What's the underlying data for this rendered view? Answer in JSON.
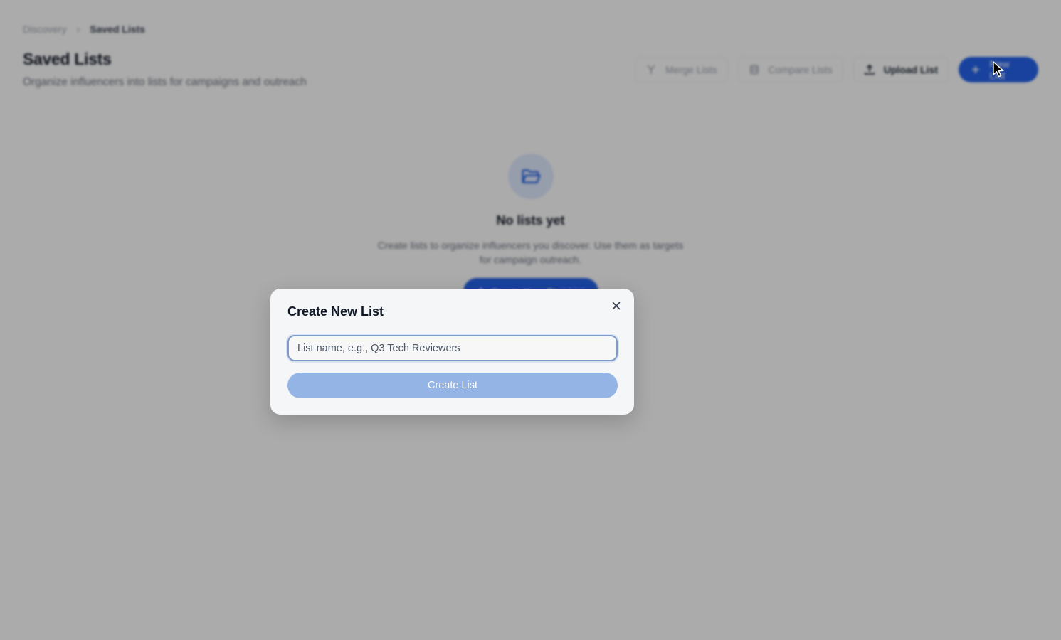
{
  "breadcrumb": {
    "parent": "Discovery",
    "separator": "›",
    "current": "Saved Lists"
  },
  "header": {
    "title": "Saved Lists",
    "subtitle": "Organize influencers into lists for campaigns and outreach"
  },
  "actions": {
    "merge_label": "Merge Lists",
    "compare_label": "Compare Lists",
    "upload_label": "Upload List",
    "new_label": "New List"
  },
  "empty_state": {
    "title": "No lists yet",
    "text": "Create lists to organize influencers you discover. Use them as targets for campaign outreach.",
    "button_label": "Create Your First List"
  },
  "modal": {
    "title": "Create New List",
    "input_placeholder": "List name, e.g., Q3 Tech Reviewers",
    "input_value": "",
    "submit_label": "Create List"
  },
  "colors": {
    "accent": "#2563eb",
    "submit_disabled": "#93b4e4",
    "overlay": "rgba(0,0,0,0.33)"
  }
}
